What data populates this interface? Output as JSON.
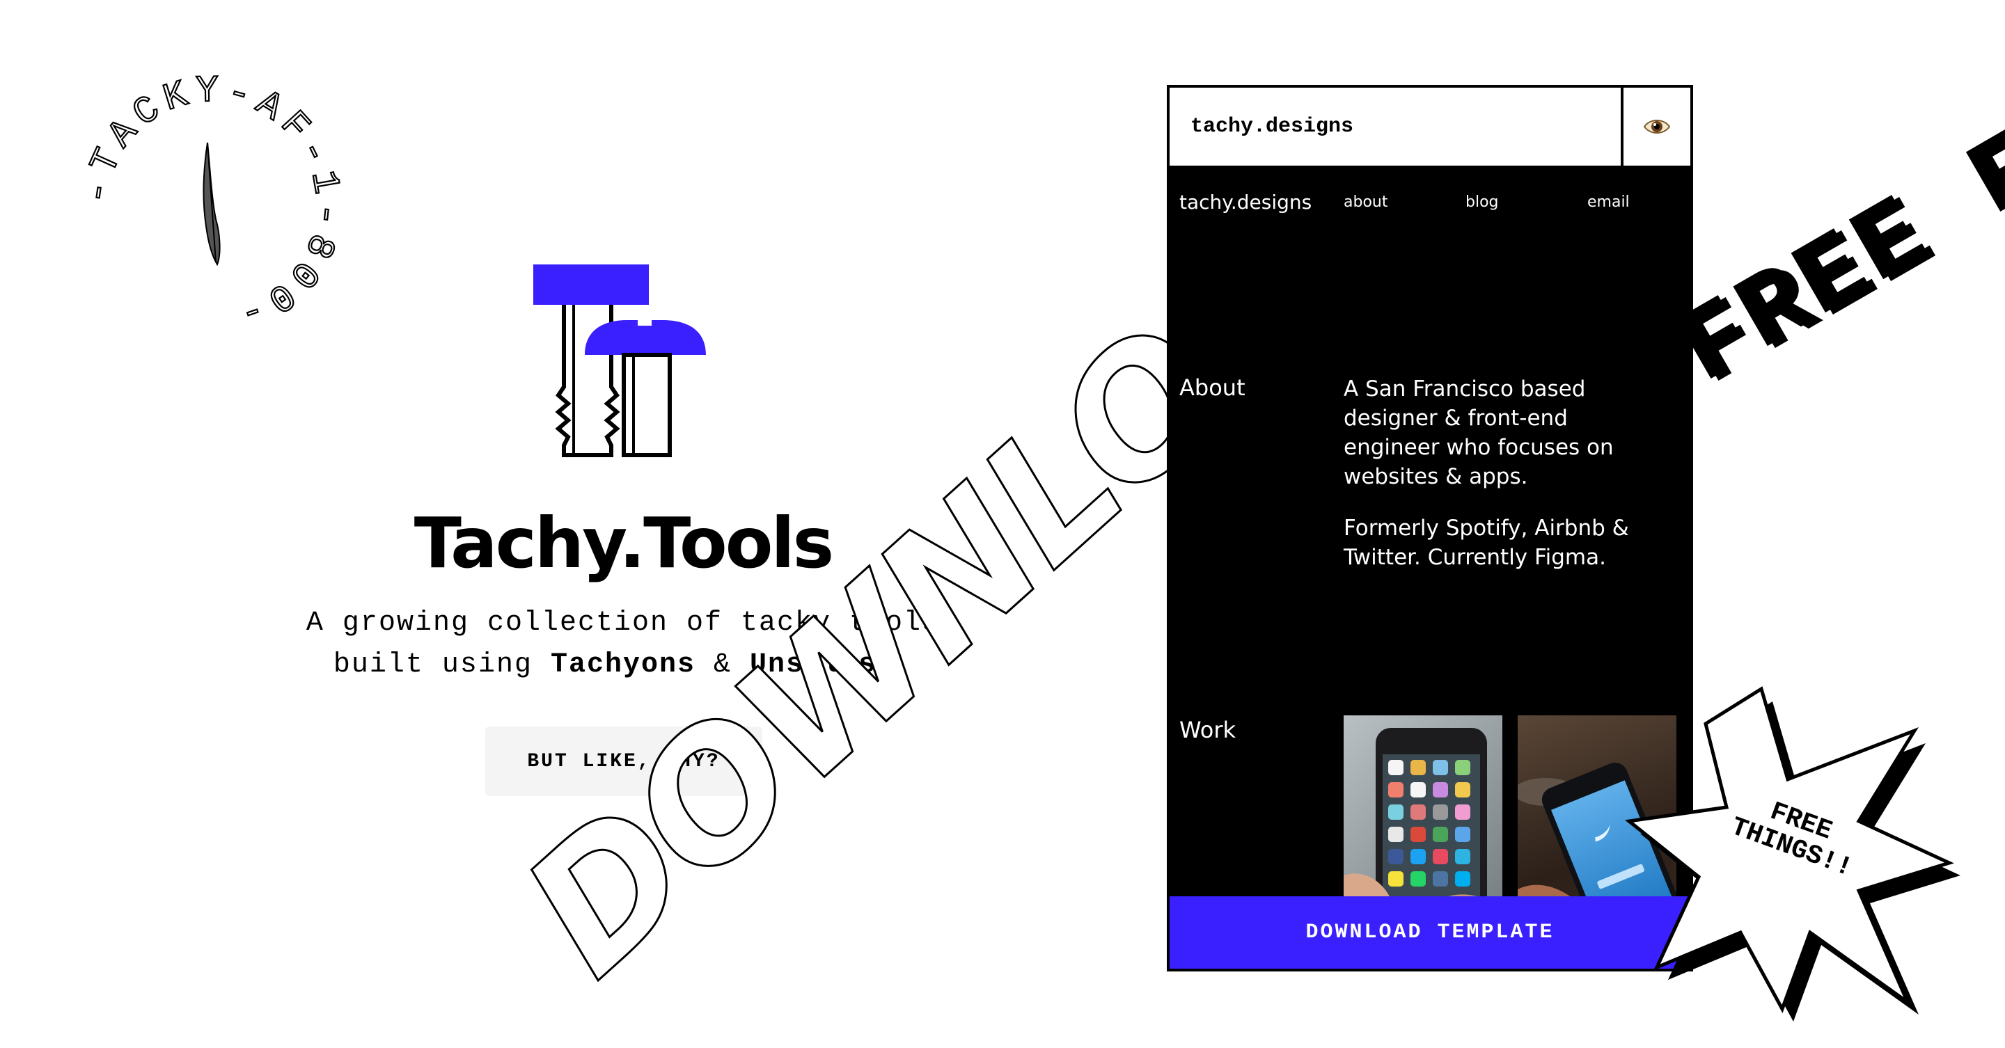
{
  "badge": {
    "text": "-TACKY-AF-1-800-"
  },
  "hero": {
    "title": "Tachy.Tools",
    "subtitle_line1": "A growing collection of tacky tools",
    "subtitle_built": "built using",
    "subtitle_tachyons": "Tachyons",
    "subtitle_amp": "&",
    "subtitle_unsplash": "Unsplash.",
    "button_label": "BUT LIKE, WHY?"
  },
  "decorations": {
    "download_word": "DOWNLOAD",
    "free_word": "FREE FREE",
    "burst_text": "FREE THINGS!!"
  },
  "preview": {
    "url": "tachy.designs",
    "nav": {
      "brand": "tachy.designs",
      "links": [
        "about",
        "blog",
        "email"
      ]
    },
    "about_label": "About",
    "about_p1": "A San Francisco based designer & front-end engineer who focuses on websites & apps.",
    "about_p2": "Formerly Spotify, Airbnb & Twitter. Currently Figma.",
    "work_label": "Work",
    "download_button": "DOWNLOAD TEMPLATE"
  },
  "colors": {
    "accent": "#3a1fff",
    "background": "#ffffff",
    "button_bg": "#f4f4f4"
  },
  "icons": [
    "feather-icon",
    "eye-icon",
    "tools-logo-icon"
  ]
}
